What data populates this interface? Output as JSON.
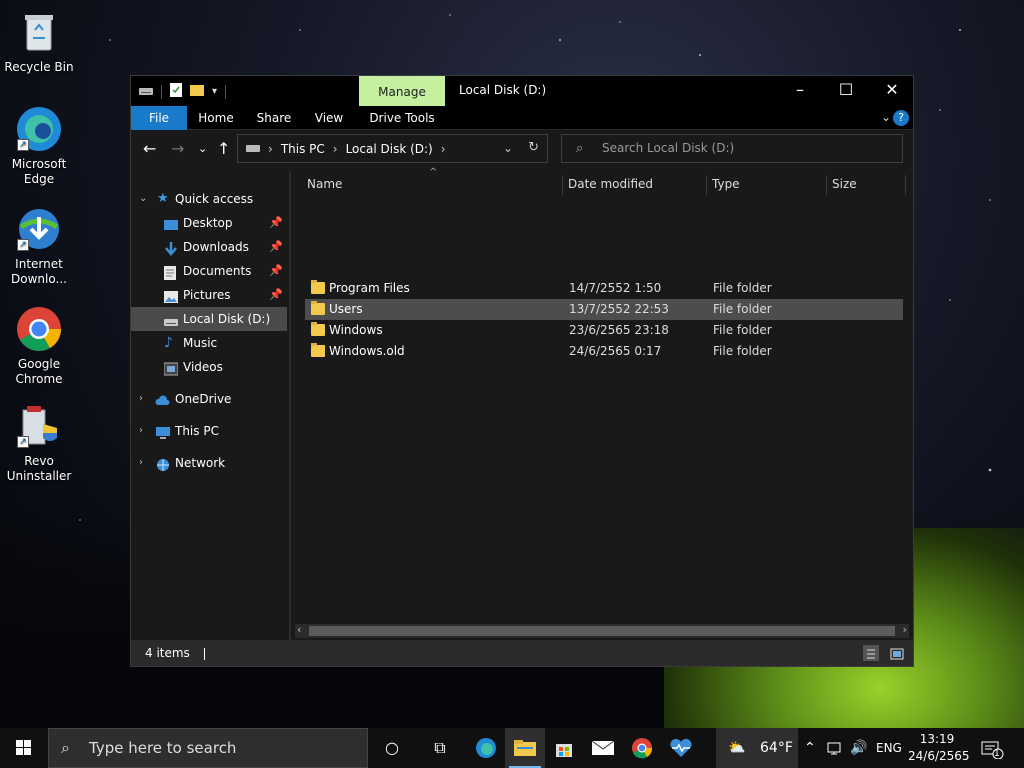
{
  "desktop": {
    "icons": [
      {
        "label": "Recycle Bin"
      },
      {
        "label": "Microsoft Edge"
      },
      {
        "label": "Internet Downlo..."
      },
      {
        "label": "Google Chrome"
      },
      {
        "label": "Revo Uninstaller"
      }
    ]
  },
  "window": {
    "title": "Local Disk (D:)",
    "manage_tab": "Manage",
    "ribbon_tabs": [
      "File",
      "Home",
      "Share",
      "View",
      "Drive Tools"
    ],
    "address": {
      "segments": [
        "This PC",
        "Local Disk (D:)"
      ]
    },
    "search_placeholder": "Search Local Disk (D:)",
    "sidebar": {
      "quick_access": "Quick access",
      "items": [
        {
          "label": "Desktop",
          "pinned": true
        },
        {
          "label": "Downloads",
          "pinned": true
        },
        {
          "label": "Documents",
          "pinned": true
        },
        {
          "label": "Pictures",
          "pinned": true
        },
        {
          "label": "Local Disk (D:)",
          "selected": true
        },
        {
          "label": "Music"
        },
        {
          "label": "Videos"
        }
      ],
      "roots": [
        "OneDrive",
        "This PC",
        "Network"
      ]
    },
    "columns": [
      "Name",
      "Date modified",
      "Type",
      "Size"
    ],
    "files": [
      {
        "name": "Program Files",
        "date": "14/7/2552 1:50",
        "type": "File folder"
      },
      {
        "name": "Users",
        "date": "13/7/2552 22:53",
        "type": "File folder",
        "highlighted": true
      },
      {
        "name": "Windows",
        "date": "23/6/2565 23:18",
        "type": "File folder"
      },
      {
        "name": "Windows.old",
        "date": "24/6/2565 0:17",
        "type": "File folder"
      }
    ],
    "status": "4 items"
  },
  "taskbar": {
    "search_placeholder": "Type here to search",
    "weather": "64°F",
    "language": "ENG",
    "time": "13:19",
    "date": "24/6/2565",
    "notification_count": "1",
    "accent": "#76b9ed"
  }
}
